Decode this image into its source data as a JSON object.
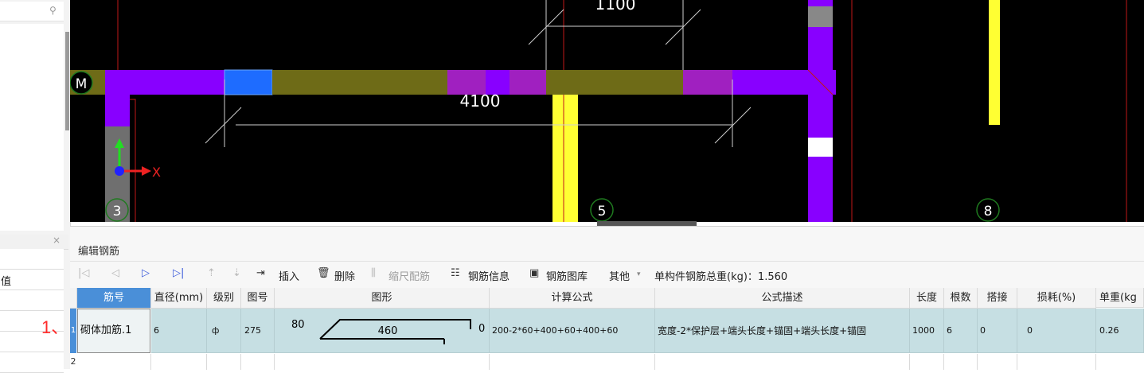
{
  "left_panel": {
    "property_value": "值"
  },
  "canvas": {
    "dim_top": "1100",
    "dim_main": "4100",
    "axis_m": "M",
    "axis_3": "3",
    "axis_5": "5",
    "axis_8": "8",
    "x_axis_label": "X"
  },
  "rebar_panel": {
    "title": "编辑钢筋",
    "toolbar": {
      "insert": "插入",
      "delete": "删除",
      "scale_rebar": "缩尺配筋",
      "rebar_info": "钢筋信息",
      "rebar_library": "钢筋图库",
      "other": "其他",
      "total_weight_label": "单构件钢筋总重(kg)：1.560"
    },
    "columns": [
      "筋号",
      "直径(mm)",
      "级别",
      "图号",
      "图形",
      "计算公式",
      "公式描述",
      "长度",
      "根数",
      "搭接",
      "损耗(%)",
      "单重(kg"
    ],
    "rows": [
      {
        "num": "1",
        "name": "砌体加筋.1",
        "diameter": "6",
        "grade": "ф",
        "shape_no": "275",
        "shape_left": "80",
        "shape_mid": "460",
        "shape_right": "0",
        "formula": "200-2*60+400+60+400+60",
        "description": "宽度-2*保护层+端头长度+锚固+端头长度+锚固",
        "length": "1000",
        "count": "6",
        "lap": "0",
        "loss": "0",
        "unit_weight": "0.26"
      }
    ],
    "row2_num": "2"
  },
  "annotation": "1、"
}
